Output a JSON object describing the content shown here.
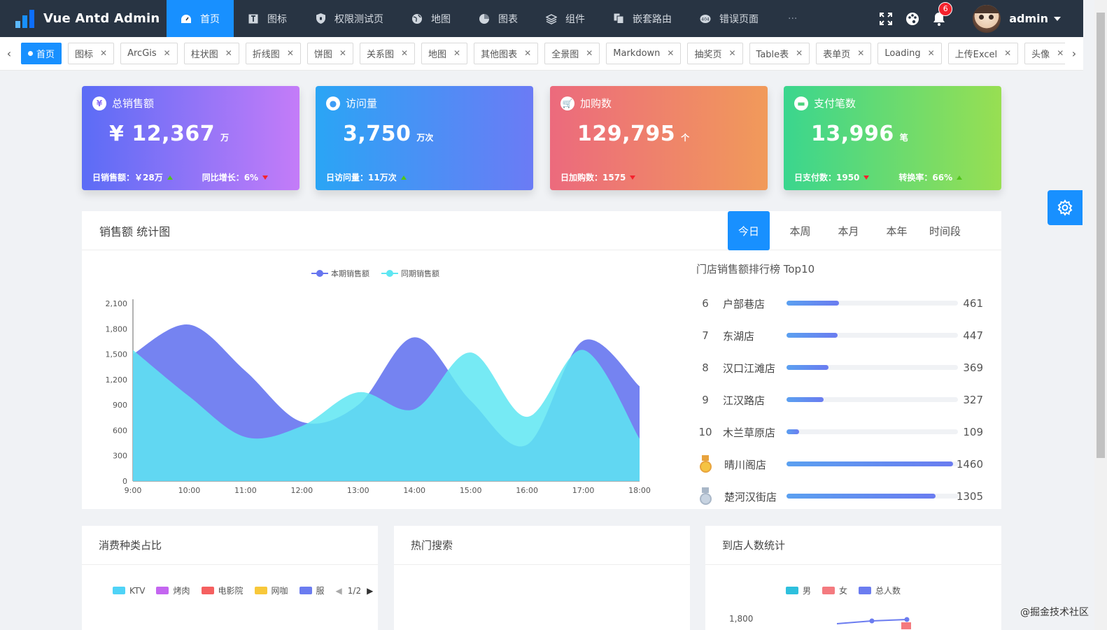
{
  "app": {
    "title": "Vue Antd Admin"
  },
  "nav": [
    {
      "label": "首页",
      "icon": "dashboard-icon",
      "active": true
    },
    {
      "label": "图标",
      "icon": "font-icon"
    },
    {
      "label": "权限测试页",
      "icon": "shield-icon"
    },
    {
      "label": "地图",
      "icon": "globe-icon"
    },
    {
      "label": "图表",
      "icon": "pie-chart-icon"
    },
    {
      "label": "组件",
      "icon": "layers-icon"
    },
    {
      "label": "嵌套路由",
      "icon": "copy-icon"
    },
    {
      "label": "错误页面",
      "icon": "error-icon"
    }
  ],
  "nav_more": "···",
  "header": {
    "notification_count": "6",
    "user_name": "admin"
  },
  "tabs": [
    {
      "label": "首页",
      "active": true
    },
    {
      "label": "图标"
    },
    {
      "label": "ArcGis"
    },
    {
      "label": "柱状图"
    },
    {
      "label": "折线图"
    },
    {
      "label": "饼图"
    },
    {
      "label": "关系图"
    },
    {
      "label": "地图"
    },
    {
      "label": "其他图表"
    },
    {
      "label": "全景图"
    },
    {
      "label": "Markdown"
    },
    {
      "label": "抽奖页"
    },
    {
      "label": "Table表"
    },
    {
      "label": "表单页"
    },
    {
      "label": "Loading"
    },
    {
      "label": "上传Excel"
    },
    {
      "label": "头像"
    }
  ],
  "cards": [
    {
      "title": "总销售额",
      "icon": "¥",
      "value": "¥ 12,367",
      "unit": "万",
      "foot1": "日销售额：￥28万",
      "foot1_trend": "up",
      "foot2": "同比增长：6%",
      "foot2_trend": "down",
      "gradient": [
        "#5b6cf6",
        "#c47cf8"
      ],
      "icon_color": "#8a6cf6"
    },
    {
      "title": "访问量",
      "icon": "●",
      "value": "3,750",
      "unit": "万次",
      "foot1": "日访问量：11万次",
      "foot1_trend": "up",
      "foot2": "",
      "foot2_trend": "",
      "gradient": [
        "#2aa5f5",
        "#6b7bf5"
      ],
      "icon_color": "#3d9cf5"
    },
    {
      "title": "加购数",
      "icon": "🛒",
      "value": "129,795",
      "unit": "个",
      "foot1": "日加购数：1575",
      "foot1_trend": "down",
      "foot2": "",
      "foot2_trend": "",
      "gradient": [
        "#ec6a7d",
        "#f19a5a"
      ],
      "icon_color": "#ee7c70"
    },
    {
      "title": "支付笔数",
      "icon": "▬",
      "value": "13,996",
      "unit": "笔",
      "foot1": "日支付数：1950",
      "foot1_trend": "down",
      "foot2": "转换率：66%",
      "foot2_trend": "up",
      "gradient": [
        "#3ad68e",
        "#98df52"
      ],
      "icon_color": "#4fd27e"
    }
  ],
  "sales_panel": {
    "title": "销售额 统计图",
    "tabs": [
      "今日",
      "本周",
      "本月",
      "本年",
      "时间段"
    ],
    "active_tab": "今日"
  },
  "chart_data": {
    "type": "area",
    "x": [
      "9:00",
      "10:00",
      "11:00",
      "12:00",
      "13:00",
      "14:00",
      "15:00",
      "16:00",
      "17:00",
      "18:00"
    ],
    "ylim": [
      0,
      2100
    ],
    "yticks": [
      "0",
      "300",
      "600",
      "900",
      "1,200",
      "1,500",
      "1,800",
      "2,100"
    ],
    "series": [
      {
        "name": "本期销售额",
        "color": "#6675ef",
        "values": [
          1500,
          1850,
          1300,
          700,
          900,
          1700,
          950,
          430,
          1660,
          1120
        ]
      },
      {
        "name": "同期销售额",
        "color": "#5ee6f2",
        "values": [
          1550,
          1000,
          520,
          650,
          1050,
          850,
          1520,
          760,
          1550,
          500
        ]
      }
    ]
  },
  "ranking": {
    "title": "门店销售额排行榜 Top10",
    "max": 1500,
    "items": [
      {
        "rank": "6",
        "name": "户部巷店",
        "value": 461
      },
      {
        "rank": "7",
        "name": "东湖店",
        "value": 447
      },
      {
        "rank": "8",
        "name": "汉口江滩店",
        "value": 369
      },
      {
        "rank": "9",
        "name": "江汉路店",
        "value": 327
      },
      {
        "rank": "10",
        "name": "木兰草原店",
        "value": 109
      },
      {
        "rank": "gold",
        "name": "晴川阁店",
        "value": 1460
      },
      {
        "rank": "silver",
        "name": "楚河汉街店",
        "value": 1305
      }
    ]
  },
  "bottom": {
    "consume": {
      "title": "消费种类占比",
      "legend": [
        {
          "name": "KTV",
          "color": "#4fd3f7"
        },
        {
          "name": "烤肉",
          "color": "#c466f0"
        },
        {
          "name": "电影院",
          "color": "#f56060"
        },
        {
          "name": "网咖",
          "color": "#f8c83a"
        },
        {
          "name": "服",
          "color": "#6b7cf0"
        }
      ],
      "pager": "1/2"
    },
    "search": {
      "title": "热门搜索"
    },
    "visitors": {
      "title": "到店人数统计",
      "legend": [
        {
          "name": "男",
          "color": "#2ec0dd"
        },
        {
          "name": "女",
          "color": "#f47a7f"
        },
        {
          "name": "总人数",
          "color": "#6b7cf0"
        }
      ],
      "ytick": "1,800"
    }
  },
  "watermark": "@掘金技术社区"
}
